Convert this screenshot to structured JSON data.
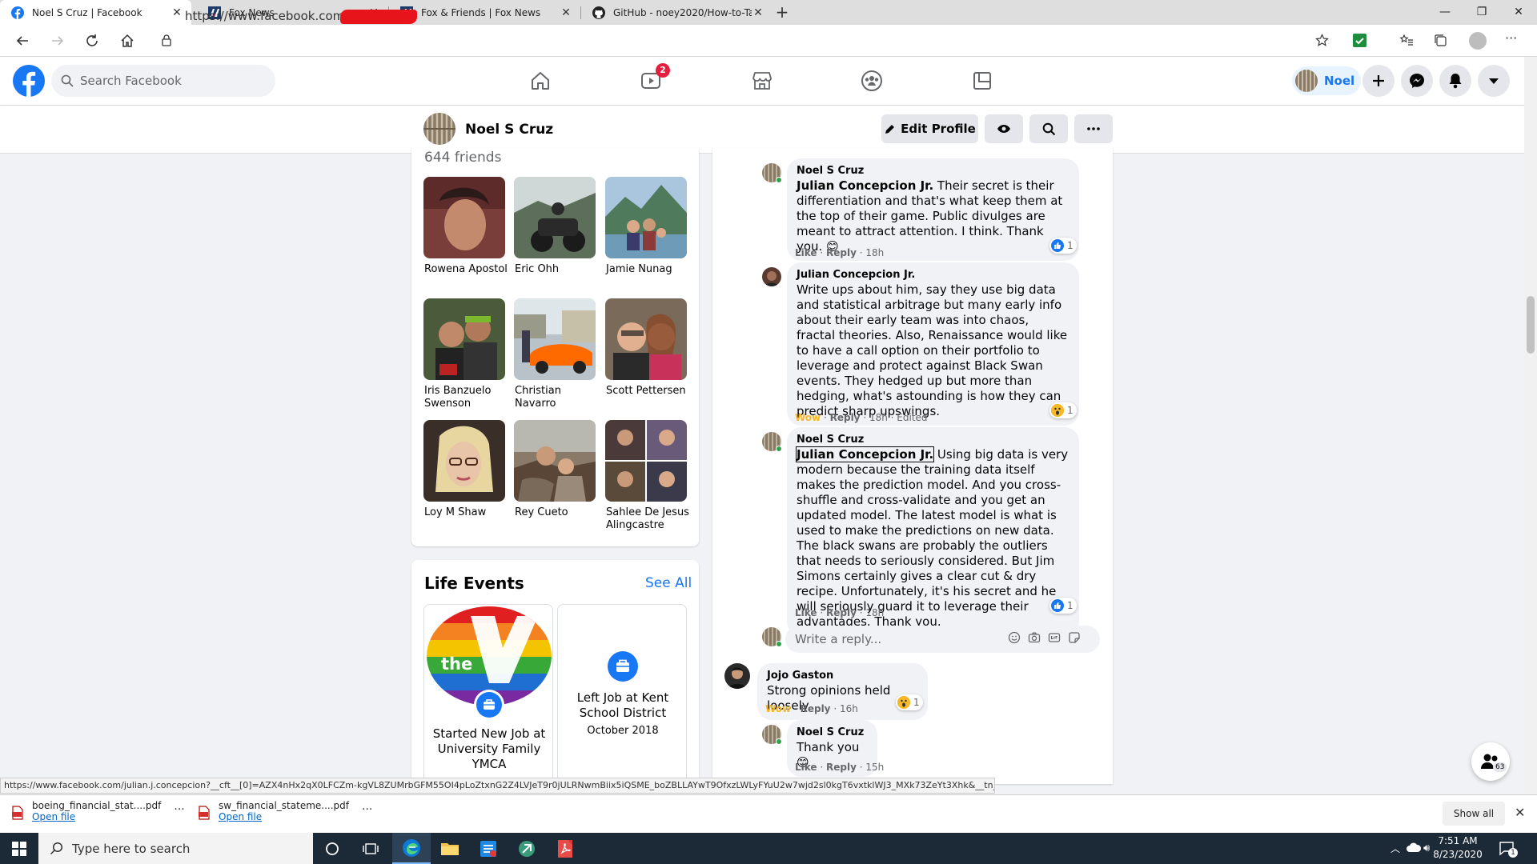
{
  "browser": {
    "tabs": [
      {
        "title": "Noel S Cruz | Facebook",
        "icon": "facebook-icon"
      },
      {
        "title": "Fox News",
        "icon": "foxnews-icon"
      },
      {
        "title": "Fox & Friends | Fox News",
        "icon": "foxnews-icon"
      },
      {
        "title": "GitHub - noey2020/How-to-Talk",
        "icon": "github-icon"
      }
    ],
    "url": "https://www.facebook.com/"
  },
  "facebook": {
    "search_placeholder": "Search Facebook",
    "video_badge": "2",
    "user_short_name": "Noel",
    "brand_color": "#1877f2"
  },
  "profile": {
    "name": "Noel S Cruz",
    "edit_label": "Edit Profile"
  },
  "friends": {
    "count_label": "644 friends",
    "list": [
      {
        "name": "Rowena Apostol"
      },
      {
        "name": "Eric Ohh"
      },
      {
        "name": "Jamie Nunag"
      },
      {
        "name": "Iris Banzuelo Swenson"
      },
      {
        "name": "Christian Navarro"
      },
      {
        "name": "Scott Pettersen"
      },
      {
        "name": "Loy M Shaw"
      },
      {
        "name": "Rey Cueto"
      },
      {
        "name": "Sahlee De Jesus Alingcastre"
      }
    ]
  },
  "life_events": {
    "title": "Life Events",
    "see_all": "See All",
    "items": [
      {
        "text": "Started New Job at University Family YMCA",
        "date": "",
        "logo_text": "the"
      },
      {
        "text": "Left Job at Kent School District",
        "date": "October 2018"
      }
    ]
  },
  "comments": [
    {
      "author": "Noel S Cruz",
      "mention": "Julian Concepcion Jr.",
      "text": " Their secret is their differentiation and that's what keep them at the top of their game. Public divulges are meant to attract attention. I think. Thank you. 😊",
      "reaction_count": "1",
      "reaction": "like",
      "action": "Like",
      "reply": "Reply",
      "time": "18h",
      "edited": ""
    },
    {
      "author": "Julian Concepcion Jr.",
      "mention": "",
      "text": "Write ups about him, say they use big data and statistical arbitrage but many early info about their early team was into chaos, fractal theories. Also, Renaissance would like to have a call option on their portfolio to leverage and protect against Black Swan events. They hedged up but more than hedging, what's astounding is how they can predict sharp upswings.",
      "reaction_count": "1",
      "reaction": "wow",
      "action": "Wow",
      "reply": "Reply",
      "time": "18h",
      "edited": "Edited"
    },
    {
      "author": "Noel S Cruz",
      "mention": "Julian Concepcion Jr.",
      "text": " Using big data is very modern because the training data itself makes the prediction model. And you cross-shuffle and cross-validate and you get an updated model. The latest model is what is used to make the predictions on new data. The black swans are probably the outliers that needs to seriously considered. But Jim Simons certainly gives a clear cut & dry recipe. Unfortunately, it's his secret and he will seriously guard it to leverage their advantages. Thank you.",
      "reaction_count": "1",
      "reaction": "like",
      "action": "Like",
      "reply": "Reply",
      "time": "18h",
      "edited": ""
    },
    {
      "author": "Jojo Gaston",
      "mention": "",
      "text": "Strong opinions held loosely.",
      "reaction_count": "1",
      "reaction": "wow",
      "action": "Wow",
      "reply": "Reply",
      "time": "16h",
      "edited": ""
    },
    {
      "author": "Noel S Cruz",
      "mention": "",
      "text": "Thank you 😊",
      "reaction_count": "",
      "reaction": "",
      "action": "Like",
      "reply": "Reply",
      "time": "15h",
      "edited": ""
    }
  ],
  "reply_placeholder": "Write a reply...",
  "status_url": "https://www.facebook.com/julian.j.concepcion?__cft__[0]=AZX4nHx2qX0LFCZm-kgVL8ZUMrbGFM55OI4pLoZtxnG2Z4LVJeT9r0jULRNwmBiix5iQSME_boZBLLAYwT9OfxzLWLyFYuU2w7wjd2sl0kgT6vxtklWJ3_MXk73ZeYt3Xhk&__tn__=R]-R",
  "chat_badge": "63",
  "downloads": {
    "items": [
      {
        "file": "boeing_financial_stat....pdf",
        "open": "Open file"
      },
      {
        "file": "sw_financial_stateme....pdf",
        "open": "Open file"
      }
    ],
    "show_all": "Show all"
  },
  "taskbar": {
    "search_placeholder": "Type here to search",
    "time": "7:51 AM",
    "date": "8/23/2020",
    "notification_count": "1"
  }
}
